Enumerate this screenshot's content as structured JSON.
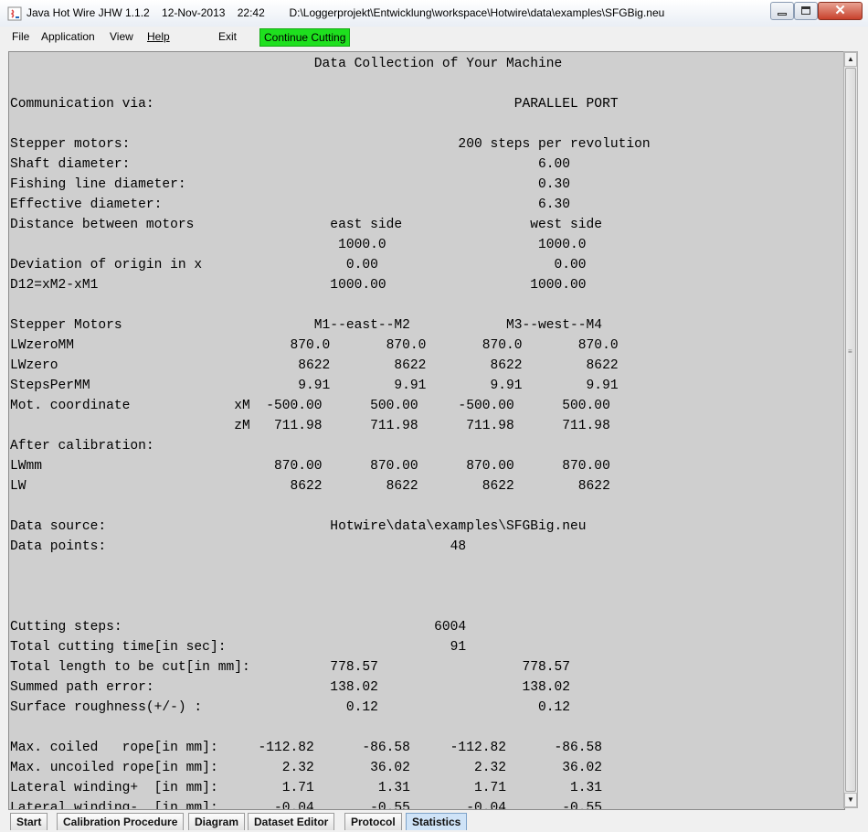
{
  "window": {
    "title": "Java Hot Wire JHW 1.1.2    12-Nov-2013    22:42        D:\\Loggerprojekt\\Entwicklung\\workspace\\Hotwire\\data\\examples\\SFGBig.neu",
    "minimize_icon": "minimize-icon",
    "maximize_icon": "maximize-icon",
    "close_glyph": "✕"
  },
  "menu": {
    "file": "File",
    "application": "Application",
    "view": "View",
    "help": "Help",
    "exit": "Exit",
    "continue": "Continue Cutting",
    "continue_color": "#1ee01e"
  },
  "report": {
    "lines": [
      "                                      Data Collection of Your Machine",
      "",
      "Communication via:                                             PARALLEL PORT",
      "",
      "Stepper motors:                                         200 steps per revolution",
      "Shaft diameter:                                                   6.00",
      "Fishing line diameter:                                            0.30",
      "Effective diameter:                                               6.30",
      "Distance between motors                 east side                west side",
      "                                         1000.0                   1000.0",
      "Deviation of origin in x                  0.00                      0.00",
      "D12=xM2-xM1                             1000.00                  1000.00",
      "",
      "Stepper Motors                        M1--east--M2            M3--west--M4",
      "LWzeroMM                           870.0       870.0       870.0       870.0",
      "LWzero                              8622        8622        8622        8622",
      "StepsPerMM                          9.91        9.91        9.91        9.91",
      "Mot. coordinate             xM  -500.00      500.00     -500.00      500.00",
      "                            zM   711.98      711.98      711.98      711.98",
      "After calibration:",
      "LWmm                             870.00      870.00      870.00      870.00",
      "LW                                 8622        8622        8622        8622",
      "",
      "Data source:                            Hotwire\\data\\examples\\SFGBig.neu",
      "Data points:                                           48",
      "",
      "",
      "",
      "Cutting steps:                                       6004",
      "Total cutting time[in sec]:                            91",
      "Total length to be cut[in mm]:          778.57                  778.57",
      "Summed path error:                      138.02                  138.02",
      "Surface roughness(+/-) :                  0.12                    0.12",
      "",
      "Max. coiled   rope[in mm]:     -112.82      -86.58     -112.82      -86.58",
      "Max. uncoiled rope[in mm]:        2.32       36.02        2.32       36.02",
      "Lateral winding+  [in mm]:        1.71        1.31        1.71        1.31",
      "Lateral winding-  [in mm]:       -0.04       -0.55       -0.04       -0.55"
    ]
  },
  "scrollbar": {
    "up": "▲",
    "down": "▼",
    "grip": "≡"
  },
  "tabs": [
    "Start",
    "Calibration Procedure",
    "Diagram",
    "Dataset Editor",
    "Protocol",
    "Statistics"
  ],
  "active_tab": "Statistics"
}
